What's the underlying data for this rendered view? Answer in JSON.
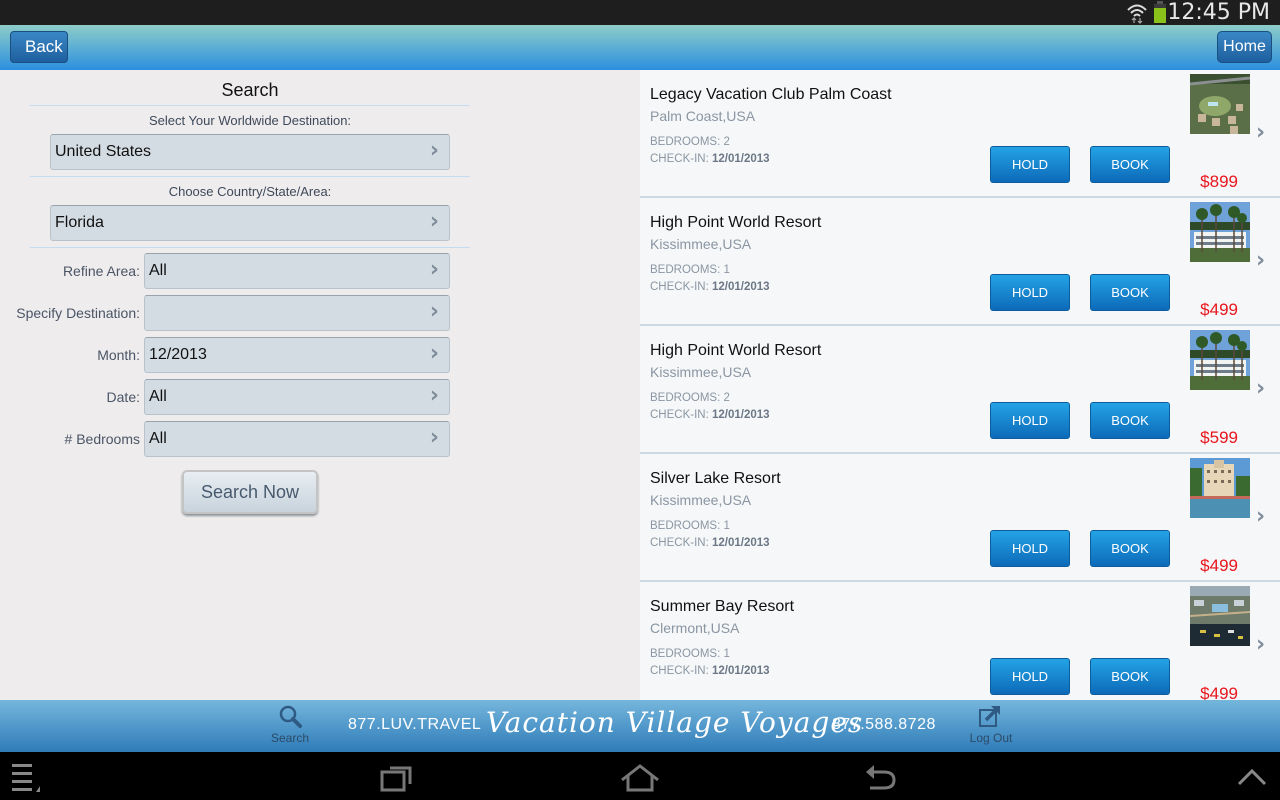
{
  "status_bar": {
    "time": "12:45 PM"
  },
  "header": {
    "back_label": "Back",
    "home_label": "Home"
  },
  "search_form": {
    "title": "Search",
    "destination_label": "Select Your Worldwide Destination:",
    "destination_value": "United States",
    "area_label": "Choose Country/State/Area:",
    "area_value": "Florida",
    "fields": [
      {
        "label": "Refine Area:",
        "value": "All"
      },
      {
        "label": "Specify Destination:",
        "value": ""
      },
      {
        "label": "Month:",
        "value": "12/2013"
      },
      {
        "label": "Date:",
        "value": "All"
      },
      {
        "label": "# Bedrooms",
        "value": "All"
      }
    ],
    "search_button": "Search Now"
  },
  "results": [
    {
      "name": "Legacy Vacation Club Palm Coast",
      "location": "Palm Coast,USA",
      "bedrooms_label": "BEDROOMS:",
      "bedrooms": "2",
      "checkin_label": "CHECK-IN:",
      "checkin": "12/01/2013",
      "hold": "HOLD",
      "book": "BOOK",
      "price": "$899"
    },
    {
      "name": "High Point World Resort",
      "location": "Kissimmee,USA",
      "bedrooms_label": "BEDROOMS:",
      "bedrooms": "1",
      "checkin_label": "CHECK-IN:",
      "checkin": "12/01/2013",
      "hold": "HOLD",
      "book": "BOOK",
      "price": "$499"
    },
    {
      "name": "High Point World Resort",
      "location": "Kissimmee,USA",
      "bedrooms_label": "BEDROOMS:",
      "bedrooms": "2",
      "checkin_label": "CHECK-IN:",
      "checkin": "12/01/2013",
      "hold": "HOLD",
      "book": "BOOK",
      "price": "$599"
    },
    {
      "name": "Silver Lake Resort",
      "location": "Kissimmee,USA",
      "bedrooms_label": "BEDROOMS:",
      "bedrooms": "1",
      "checkin_label": "CHECK-IN:",
      "checkin": "12/01/2013",
      "hold": "HOLD",
      "book": "BOOK",
      "price": "$499"
    },
    {
      "name": "Summer Bay Resort",
      "location": "Clermont,USA",
      "bedrooms_label": "BEDROOMS:",
      "bedrooms": "1",
      "checkin_label": "CHECK-IN:",
      "checkin": "12/01/2013",
      "hold": "HOLD",
      "book": "BOOK",
      "price": "$499"
    }
  ],
  "footer": {
    "search_label": "Search",
    "phone_left": "877.LUV.TRAVEL",
    "brand": "Vacation Village Voyages",
    "phone_right": "877.588.8728",
    "logout_label": "Log Out"
  },
  "colors": {
    "price": "#e8161c",
    "accent": "#1a7cc7"
  }
}
